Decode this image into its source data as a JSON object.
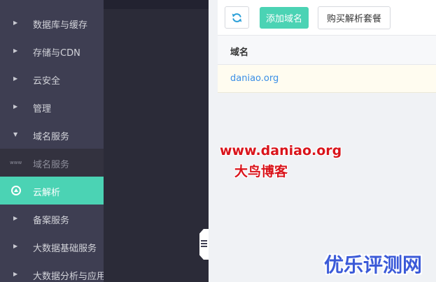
{
  "sidebar": {
    "items": [
      {
        "label": "数据库与缓存"
      },
      {
        "label": "存储与CDN"
      },
      {
        "label": "云安全"
      },
      {
        "label": "管理"
      },
      {
        "label": "域名服务"
      },
      {
        "label": "域名服务",
        "icon_text": "www"
      },
      {
        "label": "云解析"
      },
      {
        "label": "备案服务"
      },
      {
        "label": "大数据基础服务"
      },
      {
        "label": "大数据分析与应用"
      }
    ]
  },
  "toolbar": {
    "add_label": "添加域名",
    "buy_label": "购买解析套餐"
  },
  "table": {
    "header": "域名",
    "rows": [
      {
        "domain": "daniao.org"
      }
    ]
  },
  "watermark": {
    "url": "www.daniao.org",
    "blog": "大鸟博客",
    "brand": "优乐评测网"
  },
  "colors": {
    "accent": "#4bd3b4",
    "sidebar_bg": "#3e3e52",
    "link": "#3a8ee6",
    "watermark_red": "#d9141b",
    "watermark_blue": "#3b5ad8"
  }
}
